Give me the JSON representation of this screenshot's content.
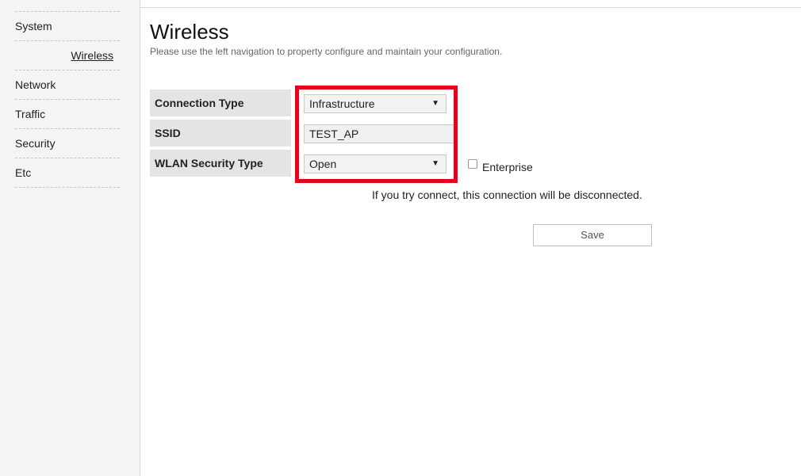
{
  "sidebar": {
    "items": [
      {
        "label": "System"
      },
      {
        "label": "Wireless"
      },
      {
        "label": "Network"
      },
      {
        "label": "Traffic"
      },
      {
        "label": "Security"
      },
      {
        "label": "Etc"
      }
    ]
  },
  "header": {
    "title": "Wireless",
    "subtitle": "Please use the left navigation to property configure and maintain your configuration."
  },
  "form": {
    "connection_type_label": "Connection Type",
    "connection_type_value": "Infrastructure",
    "ssid_label": "SSID",
    "ssid_value": "TEST_AP",
    "security_type_label": "WLAN Security Type",
    "security_type_value": "Open",
    "enterprise_label": "Enterprise",
    "dropdown_arrow": "▼"
  },
  "notice": "If you try connect, this connection will be disconnected.",
  "save_label": "Save",
  "colors": {
    "highlight": "#e8001c",
    "sidebar_bg": "#f4f4f4",
    "label_bg": "#e4e4e4"
  }
}
